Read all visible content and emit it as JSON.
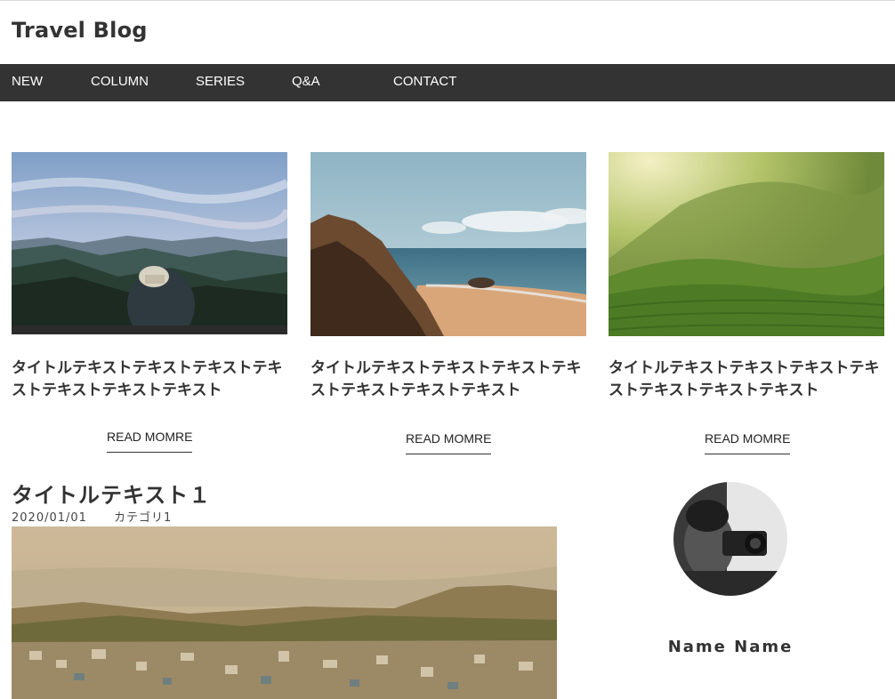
{
  "header": {
    "title": "Travel Blog"
  },
  "nav": {
    "items": [
      {
        "label": "NEW"
      },
      {
        "label": "COLUMN"
      },
      {
        "label": "SERIES"
      },
      {
        "label": "Q&A"
      },
      {
        "label": "CONTACT"
      }
    ]
  },
  "cards": [
    {
      "title": "タイトルテキストテキストテキストテキストテキストテキストテキスト",
      "read_more": "READ MOMRE"
    },
    {
      "title": "タイトルテキストテキストテキストテキストテキストテキストテキスト",
      "read_more": "READ MOMRE"
    },
    {
      "title": "タイトルテキストテキストテキストテキストテキストテキストテキスト",
      "read_more": "READ MOMRE"
    }
  ],
  "post": {
    "title": "タイトルテキスト１",
    "date": "2020/01/01",
    "category": "カテゴリ1"
  },
  "profile": {
    "name": "Name Name"
  },
  "colors": {
    "nav_bg": "#333333",
    "text": "#333333"
  }
}
